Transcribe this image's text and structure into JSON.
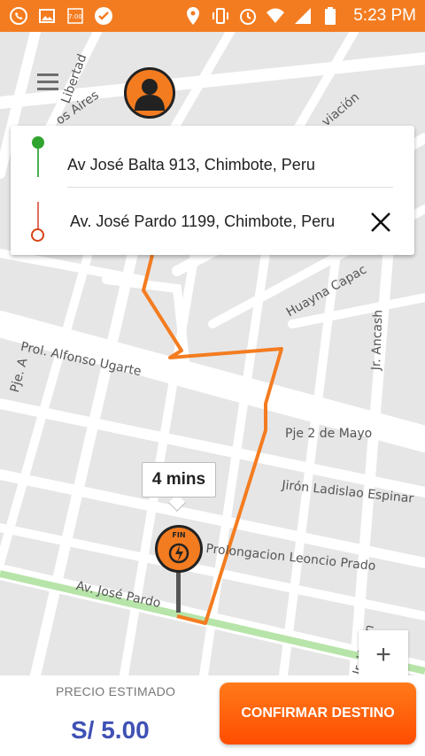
{
  "status_bar": {
    "time": "5:23 PM",
    "icons": [
      "whatsapp-icon",
      "gallery-icon",
      "data-icon",
      "check-icon",
      "location-icon",
      "vibrate-icon",
      "alarm-icon",
      "wifi-icon",
      "signal-icon",
      "battery-icon"
    ]
  },
  "map": {
    "street_labels": {
      "libertad": "Libertad",
      "aires": "os Aires",
      "aviacion": "viación",
      "huayna": "Huayna Capac",
      "ugarte": "Prol. Alfonso Ugarte",
      "pje_a": "Pje. A",
      "ancash": "Jr. Ancash",
      "pje2": "Pje 2 de Mayo",
      "ladislao": "Jirón Ladislao Espinar",
      "leoncio": "Prolongacion Leoncio Prado",
      "pardo": "Av. José Pardo",
      "union": "Jr. Unión"
    },
    "route_color": "#f47c20",
    "park_color": "#b7e4a8"
  },
  "route": {
    "origin": "Av José Balta 913, Chimbote, Peru",
    "destination": "Av. José Pardo 1199, Chimbote, Peru"
  },
  "eta": {
    "label": "4 mins"
  },
  "marker": {
    "label": "FIN"
  },
  "zoom": {
    "plus_label": "+"
  },
  "bottom": {
    "price_label": "PRECIO ESTIMADO",
    "price_value": "S/ 5.00",
    "confirm_label": "CONFIRMAR DESTINO"
  }
}
